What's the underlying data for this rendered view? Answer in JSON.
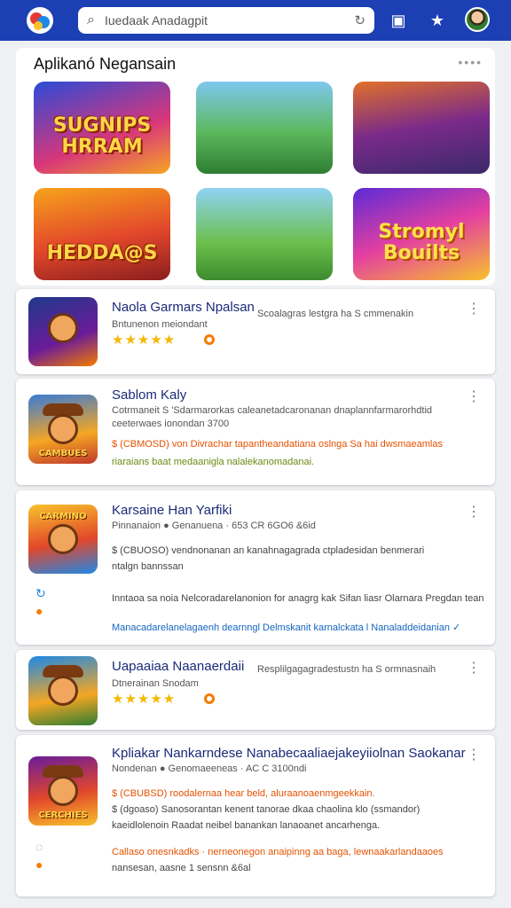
{
  "search": {
    "value": "Iuedaak Anadagpit"
  },
  "featured": {
    "title": "Aplikanó Negansain",
    "more": "••••",
    "tiles": [
      {
        "label": "SUGNIPS HRRAM",
        "bg": "linear-gradient(160deg,#2a4bd8,#d8367a 60%,#f5a623)"
      },
      {
        "label": "",
        "bg": "linear-gradient(180deg,#7ec8f0,#5cb85c 55%,#2e7d32)"
      },
      {
        "label": "",
        "bg": "linear-gradient(170deg,#e0702a,#7a2a8a 50%,#3a2a6a)"
      },
      {
        "label": "HEDDA@S",
        "bg": "linear-gradient(170deg,#f7a21b,#e2472b 55%,#8a1e1e)"
      },
      {
        "label": "",
        "bg": "linear-gradient(180deg,#8fd3f4,#6bbf4a 60%,#3d8b2f)"
      },
      {
        "label": "Stromyl Bouilts",
        "bg": "linear-gradient(160deg,#5b2bd6,#e43fa0 50%,#f7c22b)"
      }
    ]
  },
  "cards": [
    {
      "title": "Naola Garmars Npalsan",
      "sub": "Bntunenon meiondant",
      "desc": "Scoalagras lestgra  ha  S cmmenakin",
      "stars": "★★★★★",
      "thumb_caption": "",
      "thumb_bg": "linear-gradient(160deg,#1e3a8a,#6a1b9a 60%,#f57c00)"
    },
    {
      "title": "Sablom Kaly",
      "sub1": "Cotrmaneit  S 'Sdarmarorkas  caleanetadcaronanan  dnaplannfarmarorhdtid",
      "sub2": "ceeterwaes ionondan  3700",
      "line1": "$ (CBMOSD)  von  Divrachar tapantheandatiana oslnga  Sa  hai  dwsmaeamlas",
      "line2": "riaraians baat  medaanigla  nalalekanomadanai.",
      "thumb_caption": "CAMBUES",
      "thumb_bg": "linear-gradient(170deg,#3a7bd5,#f5a623 60%,#c0392b)"
    },
    {
      "title": "Karsaine Han Yarfiki",
      "sub": "Pinnanaion  ●  Genanuena  ·  653 CR 6GO6  &6id",
      "line1": "$ (CBUOSO)  vendnonanan an kanahnagagrada  ctpladesidan benmerari",
      "line2": "ntalgn bannssan",
      "line3": "Inntaoa  sa noia  Nelcoradarelanonion  for anagrg  kak  Sifan  liasr  Olarnara  Pregdan  tean",
      "line4": "Manacadarelanelagaenh dearnngl  Delmskanit karnalckata  l  Nanaladdeidanian  ✓",
      "thumb_caption": "CARMINO",
      "thumb_bg": "linear-gradient(170deg,#f7c22b,#e2472b 55%,#1e88e5)"
    },
    {
      "title": "Uapaaiaa Naanaerdaii",
      "sub": "Dtnerainan  Snodam",
      "desc": "Resplilgagagradestustn  ha  S ormnasnaih",
      "stars": "★★★★★",
      "thumb_caption": "",
      "thumb_bg": "linear-gradient(170deg,#1e88e5,#f5a623 60%,#2e7d32)"
    },
    {
      "title": "Kpliakar Nankarndese Nanabecaaliaejakeyiiolnan Saokanar",
      "sub": "Nondenan  ●  Genomaeeneas  ·  AC C 3100ndi",
      "line1": "$ (CBUBSD)  roodalernaa  hear  beld,  aluraanoaenmgeekkain.",
      "line2": "$ (dgoaso)  Sanosorantan  kenent  tanorae  dkaa  chaolina  klo  (ssmandor)",
      "line3": "kaeidlolenoin  Raadat  neibel  banankan  lanaoanet  ancarhenga.",
      "line4": "Callaso onesnkadks  ·  nerneonegon  anaipinng  aa  baga,  lewnaakarlandaaoes",
      "line5": "nansesan,  aasne  1 sensnn  &6al",
      "thumb_caption": "CERCHIES",
      "thumb_bg": "linear-gradient(170deg,#6a1b9a,#e2472b 55%,#f7c22b)"
    }
  ]
}
